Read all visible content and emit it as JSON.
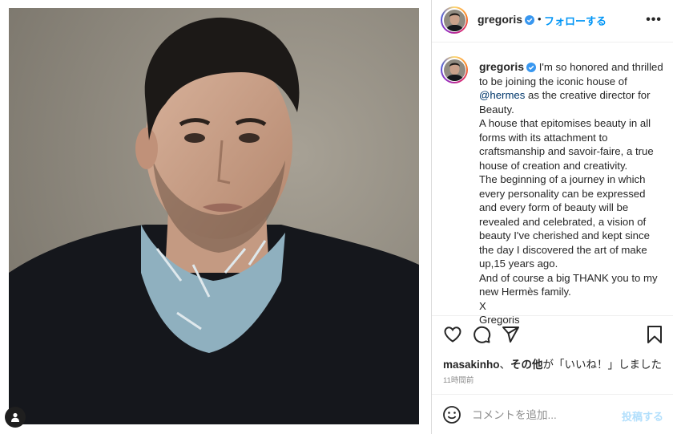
{
  "post": {
    "username": "gregoris",
    "follow_label": "フォローする",
    "separator": "•",
    "caption_lines": [
      "I'm so honored and thrilled to be joining the iconic house of",
      "@hermes",
      "as the creative director for Beauty.",
      "A house that epitomises beauty in all forms with its attachment to craftsmanship and savoir-faire, a true house of creation and creativity.",
      "The beginning of a journey in which every personality can be expressed and every form of beauty will be revealed and celebrated, a vision of beauty I've cherished and kept since the day I discovered the art of make up,15 years ago.",
      "And of course a big THANK you to my new Hermès family.",
      "X",
      "Gregoris"
    ],
    "likes": {
      "user": "masakinho",
      "sep": "、",
      "others": "その他",
      "suffix": "が「いいね！」しました"
    },
    "timestamp": "11時間前"
  },
  "comment": {
    "placeholder": "コメントを追加...",
    "post_label": "投稿する"
  },
  "icons": {
    "verified": "verified-badge-icon",
    "like": "heart-icon",
    "comment": "comment-bubble-icon",
    "share": "paper-plane-icon",
    "save": "bookmark-icon",
    "emoji": "smiley-face-icon",
    "more": "more-options-icon",
    "tag": "user-tag-icon"
  },
  "colors": {
    "link_blue": "#0095f6",
    "mention_blue": "#00376b",
    "verified_blue": "#3897f0",
    "post_disabled": "#b2dffc"
  }
}
